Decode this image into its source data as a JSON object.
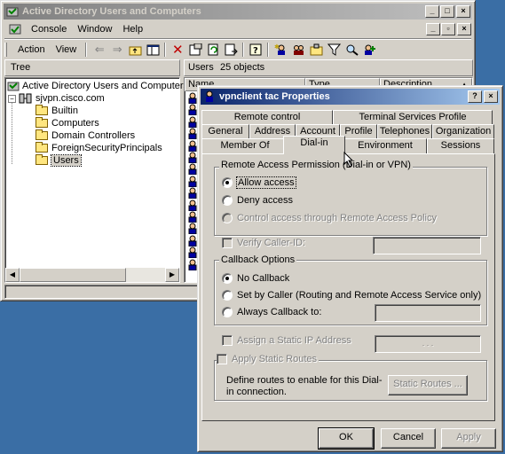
{
  "mmc": {
    "title": "Active Directory Users and Computers",
    "menu": {
      "console": "Console",
      "window": "Window",
      "help": "Help"
    },
    "menu2": {
      "action": "Action",
      "view": "View"
    },
    "tree_tab": "Tree",
    "list_header": {
      "container": "Users",
      "count": "25 objects"
    },
    "columns": {
      "name": "Name",
      "type": "Type",
      "description": "Description"
    },
    "tree": {
      "root": "Active Directory Users and Computers [cisc",
      "domain": "sjvpn.cisco.com",
      "items": [
        "Builtin",
        "Computers",
        "Domain Controllers",
        "ForeignSecurityPrincipals",
        "Users"
      ],
      "selected": "Users"
    }
  },
  "dialog": {
    "title": "vpnclient tac Properties",
    "tabs_row1": [
      "Remote control",
      "Terminal Services Profile"
    ],
    "tabs_row2": [
      "General",
      "Address",
      "Account",
      "Profile",
      "Telephones",
      "Organization"
    ],
    "tabs_row3": [
      "Member Of",
      "Dial-in",
      "Environment",
      "Sessions"
    ],
    "active_tab": "Dial-in",
    "remote_access": {
      "label": "Remote Access Permission (Dial-in or VPN)",
      "allow": "Allow access",
      "deny": "Deny access",
      "policy": "Control access through Remote Access Policy",
      "selected": "allow"
    },
    "verify_caller_id": "Verify Caller-ID:",
    "callback": {
      "label": "Callback Options",
      "no_callback": "No Callback",
      "set_by_caller": "Set by Caller (Routing and Remote Access Service only)",
      "always": "Always Callback to:",
      "selected": "no_callback"
    },
    "static_ip": {
      "label": "Assign a Static IP Address",
      "dots": ".   .   ."
    },
    "static_routes": {
      "label": "Apply Static Routes",
      "description": "Define routes to enable for this Dial-in connection.",
      "button": "Static Routes ..."
    },
    "buttons": {
      "ok": "OK",
      "cancel": "Cancel",
      "apply": "Apply"
    }
  }
}
